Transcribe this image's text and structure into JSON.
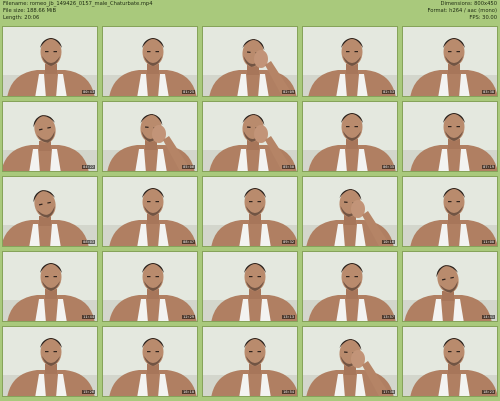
{
  "header": {
    "filename": "Filename: romeo_jb_149426_0157_male_Chaturbate.mp4",
    "filesize": "File size: 188.66 MiB",
    "length": "Length: 20:06",
    "dimensions": "Dimensions: 800x450",
    "format": "Format: h264 / aac (mono)",
    "fps": "FPS: 30.00"
  },
  "thumbnails": [
    {
      "time": "00:43",
      "pose": "front"
    },
    {
      "time": "01:25",
      "pose": "front"
    },
    {
      "time": "02:09",
      "pose": "hand"
    },
    {
      "time": "02:53",
      "pose": "front"
    },
    {
      "time": "03:38",
      "pose": "front"
    },
    {
      "time": "04:22",
      "pose": "tilt"
    },
    {
      "time": "05:06",
      "pose": "hand"
    },
    {
      "time": "05:50",
      "pose": "hand"
    },
    {
      "time": "06:35",
      "pose": "front"
    },
    {
      "time": "07:19",
      "pose": "front"
    },
    {
      "time": "08:03",
      "pose": "tilt"
    },
    {
      "time": "08:47",
      "pose": "front"
    },
    {
      "time": "09:32",
      "pose": "front"
    },
    {
      "time": "10:16",
      "pose": "hand"
    },
    {
      "time": "11:00",
      "pose": "front"
    },
    {
      "time": "11:44",
      "pose": "front"
    },
    {
      "time": "12:29",
      "pose": "front"
    },
    {
      "time": "13:13",
      "pose": "front"
    },
    {
      "time": "13:57",
      "pose": "front"
    },
    {
      "time": "14:41",
      "pose": "tilt"
    },
    {
      "time": "15:26",
      "pose": "front"
    },
    {
      "time": "16:10",
      "pose": "front"
    },
    {
      "time": "16:54",
      "pose": "front"
    },
    {
      "time": "17:38",
      "pose": "hand"
    },
    {
      "time": "18:23",
      "pose": "front"
    }
  ]
}
